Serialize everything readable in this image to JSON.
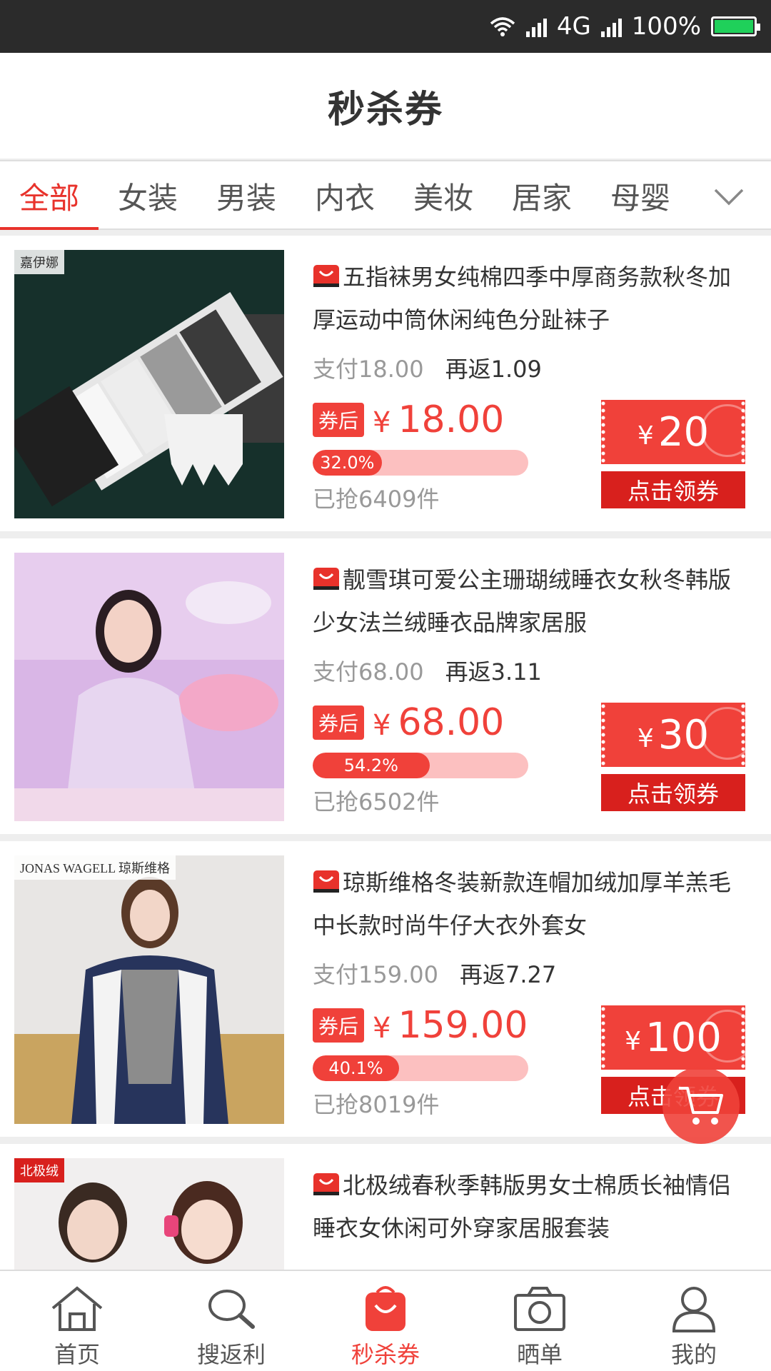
{
  "status_bar": {
    "network": "4G",
    "battery": "100%"
  },
  "header": {
    "title": "秒杀券"
  },
  "tabs": [
    {
      "label": "全部",
      "active": true
    },
    {
      "label": "女装"
    },
    {
      "label": "男装"
    },
    {
      "label": "内衣"
    },
    {
      "label": "美妆"
    },
    {
      "label": "居家"
    },
    {
      "label": "母婴"
    }
  ],
  "products": [
    {
      "brand": "嘉伊娜",
      "title": "五指袜男女纯棉四季中厚商务款秋冬加厚运动中筒休闲纯色分趾袜子",
      "pay": "支付18.00",
      "cashback": "再返1.09",
      "after_label": "券后",
      "yen": "¥",
      "price": "18.00",
      "progress_text": "32.0%",
      "progress": 0.32,
      "sold": "已抢6409件",
      "coupon_value": "20",
      "coupon_btn": "点击领券"
    },
    {
      "brand": "",
      "title": "靓雪琪可爱公主珊瑚绒睡衣女秋冬韩版少女法兰绒睡衣品牌家居服",
      "pay": "支付68.00",
      "cashback": "再返3.11",
      "after_label": "券后",
      "yen": "¥",
      "price": "68.00",
      "progress_text": "54.2%",
      "progress": 0.542,
      "sold": "已抢6502件",
      "coupon_value": "30",
      "coupon_btn": "点击领券"
    },
    {
      "brand": "JONAS WAGELL 琼斯维格",
      "title": "琼斯维格冬装新款连帽加绒加厚羊羔毛中长款时尚牛仔大衣外套女",
      "pay": "支付159.00",
      "cashback": "再返7.27",
      "after_label": "券后",
      "yen": "¥",
      "price": "159.00",
      "progress_text": "40.1%",
      "progress": 0.401,
      "sold": "已抢8019件",
      "coupon_value": "100",
      "coupon_btn": "点击领券"
    },
    {
      "brand": "北极绒",
      "title": "北极绒春秋季韩版男女士棉质长袖情侣睡衣女休闲可外穿家居服套装",
      "pay": "",
      "cashback": "",
      "after_label": "",
      "yen": "",
      "price": "",
      "progress_text": "",
      "progress": 0,
      "sold": "",
      "coupon_value": "",
      "coupon_btn": ""
    }
  ],
  "bottom_nav": [
    {
      "label": "首页",
      "icon": "home-icon"
    },
    {
      "label": "搜返利",
      "icon": "search-icon"
    },
    {
      "label": "秒杀券",
      "icon": "bag-icon",
      "active": true
    },
    {
      "label": "晒单",
      "icon": "camera-icon"
    },
    {
      "label": "我的",
      "icon": "user-icon"
    }
  ],
  "colors": {
    "accent": "#f0413a",
    "accent_dark": "#d8201d",
    "progress_track": "#fcc0c0"
  }
}
